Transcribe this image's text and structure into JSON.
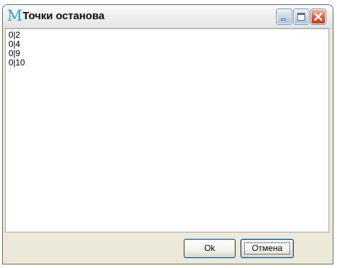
{
  "window": {
    "title": "Точки останова",
    "app_icon_glyph": "M"
  },
  "titlebar_buttons": [
    {
      "name": "minimize-icon"
    },
    {
      "name": "maximize-icon"
    },
    {
      "name": "close-icon"
    }
  ],
  "breakpoints": [
    "0|2",
    "0|4",
    "0|9",
    "0|10"
  ],
  "buttons": {
    "ok_label": "Ok",
    "cancel_label": "Отмена"
  },
  "colors": {
    "app_icon": "#25a6b3",
    "close_button": "#e1633f",
    "window_face": "#ece9d8",
    "button_border": "#003c74"
  }
}
